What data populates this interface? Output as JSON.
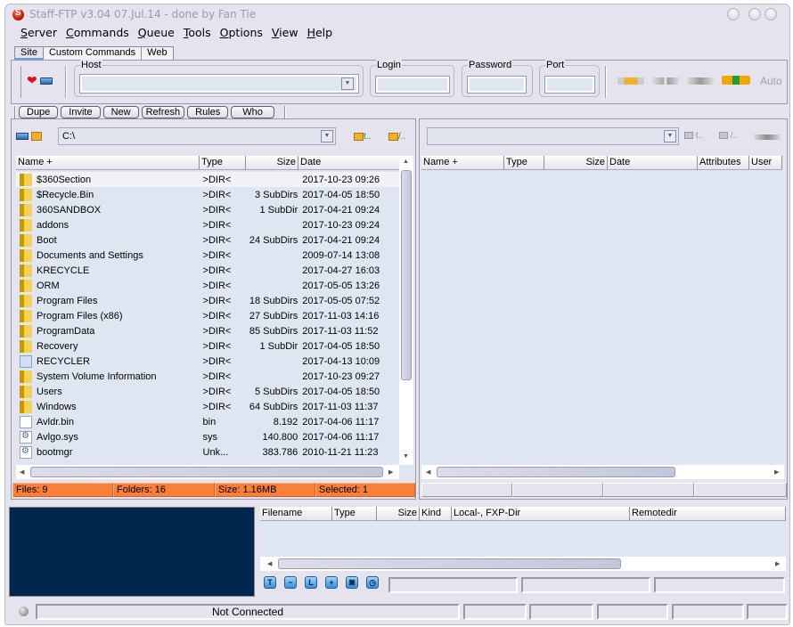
{
  "window": {
    "title": "Staff-FTP v3.04 07.Jul.14 - done by Fan Tie"
  },
  "menu": [
    {
      "label": "Server",
      "accel": "S",
      "rest": "erver"
    },
    {
      "label": "Commands",
      "accel": "C",
      "rest": "ommands"
    },
    {
      "label": "Queue",
      "accel": "Q",
      "rest": "ueue"
    },
    {
      "label": "Tools",
      "accel": "T",
      "rest": "ools"
    },
    {
      "label": "Options",
      "accel": "O",
      "rest": "ptions"
    },
    {
      "label": "View",
      "accel": "V",
      "rest": "iew"
    },
    {
      "label": "Help",
      "accel": "H",
      "rest": "elp"
    }
  ],
  "tabs": [
    {
      "label": "Site",
      "active": true
    },
    {
      "label": "Custom Commands",
      "active": false
    },
    {
      "label": "Web",
      "active": false
    }
  ],
  "connection": {
    "host_label": "Host",
    "host_value": "",
    "login_label": "Login",
    "login_value": "",
    "password_label": "Password",
    "password_value": "",
    "port_label": "Port",
    "port_value": "",
    "auto_label": "Auto"
  },
  "site_buttons": [
    "Dupe",
    "Invite",
    "New",
    "Refresh",
    "Rules",
    "Who"
  ],
  "local": {
    "path": "C:\\",
    "columns": [
      "Name +",
      "Type",
      "Size",
      "Date"
    ],
    "rows": [
      {
        "name": "$360Section",
        "type": ">DIR<",
        "size": "",
        "date": "2017-10-23 09:26",
        "icon": "folder",
        "selected": true
      },
      {
        "name": "$Recycle.Bin",
        "type": ">DIR<",
        "size": "3 SubDirs",
        "date": "2017-04-05 18:50",
        "icon": "folder"
      },
      {
        "name": "360SANDBOX",
        "type": ">DIR<",
        "size": "1 SubDir",
        "date": "2017-04-21 09:24",
        "icon": "folder"
      },
      {
        "name": "addons",
        "type": ">DIR<",
        "size": "",
        "date": "2017-10-23 09:24",
        "icon": "folder"
      },
      {
        "name": "Boot",
        "type": ">DIR<",
        "size": "24 SubDirs",
        "date": "2017-04-21 09:24",
        "icon": "folder"
      },
      {
        "name": "Documents and Settings",
        "type": ">DIR<",
        "size": "",
        "date": "2009-07-14 13:08",
        "icon": "folder"
      },
      {
        "name": "KRECYCLE",
        "type": ">DIR<",
        "size": "",
        "date": "2017-04-27 16:03",
        "icon": "folder"
      },
      {
        "name": "ORM",
        "type": ">DIR<",
        "size": "",
        "date": "2017-05-05 13:26",
        "icon": "folder"
      },
      {
        "name": "Program Files",
        "type": ">DIR<",
        "size": "18 SubDirs",
        "date": "2017-05-05 07:52",
        "icon": "folder"
      },
      {
        "name": "Program Files (x86)",
        "type": ">DIR<",
        "size": "27 SubDirs",
        "date": "2017-11-03 14:16",
        "icon": "folder"
      },
      {
        "name": "ProgramData",
        "type": ">DIR<",
        "size": "85 SubDirs",
        "date": "2017-11-03 11:52",
        "icon": "folder"
      },
      {
        "name": "Recovery",
        "type": ">DIR<",
        "size": "1 SubDir",
        "date": "2017-04-05 18:50",
        "icon": "folder"
      },
      {
        "name": "RECYCLER",
        "type": ">DIR<",
        "size": "",
        "date": "2017-04-13 10:09",
        "icon": "recycle"
      },
      {
        "name": "System Volume Information",
        "type": ">DIR<",
        "size": "",
        "date": "2017-10-23 09:27",
        "icon": "folder"
      },
      {
        "name": "Users",
        "type": ">DIR<",
        "size": "5 SubDirs",
        "date": "2017-04-05 18:50",
        "icon": "folder"
      },
      {
        "name": "Windows",
        "type": ">DIR<",
        "size": "64 SubDirs",
        "date": "2017-11-03 11:37",
        "icon": "folder"
      },
      {
        "name": "Avldr.bin",
        "type": "bin",
        "size": "8.192",
        "date": "2017-04-06 11:17",
        "icon": "file"
      },
      {
        "name": "Avlgo.sys",
        "type": "sys",
        "size": "140.800",
        "date": "2017-04-06 11:17",
        "icon": "sys"
      },
      {
        "name": "bootmgr",
        "type": "Unk...",
        "size": "383.786",
        "date": "2010-11-21 11:23",
        "icon": "sys"
      }
    ],
    "status": {
      "files": "Files: 9",
      "folders": "Folders: 16",
      "size": "Size: 1.16MB",
      "selected": "Selected: 1"
    },
    "status_color": "#fa7f3a"
  },
  "remote": {
    "path": "",
    "columns": [
      "Name +",
      "Type",
      "Size",
      "Date",
      "Attributes",
      "User"
    ],
    "rows": []
  },
  "queue": {
    "columns": [
      "Filename",
      "Type",
      "Size",
      "Kind",
      "Local-, FXP-Dir",
      "Remotedir"
    ],
    "rows": []
  },
  "queue_tools": [
    "T",
    "−",
    "L",
    "+",
    "💾",
    "◷"
  ],
  "statusbar": {
    "connection": "Not Connected"
  },
  "colors": {
    "log_bg": "#00264d",
    "window_bg": "#e4e3ee",
    "list_bg": "#dfe6f1"
  }
}
